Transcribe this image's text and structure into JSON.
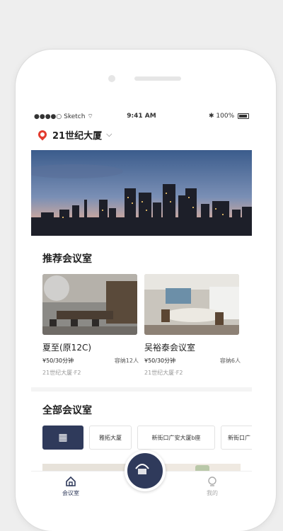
{
  "status_bar": {
    "carrier": "Sketch",
    "time": "9:41 AM",
    "battery": "100%"
  },
  "location": {
    "name": "21世纪大厦",
    "chevron_icon": "chevron-down-icon",
    "pin_icon": "map-pin-icon"
  },
  "recommended": {
    "title": "推荐会议室",
    "rooms": [
      {
        "name": "夏至(原12C)",
        "price": "¥50/30分钟",
        "capacity": "容纳12人",
        "address": "21世纪大厦·F2"
      },
      {
        "name": "吴裕泰会议室",
        "price": "¥50/30分钟",
        "capacity": "容纳6人",
        "address": "21世纪大厦·F2"
      }
    ]
  },
  "all_rooms": {
    "title": "全部会议室",
    "filters": [
      "",
      "雅拓大厦",
      "新街口广安大厦b座",
      "新街口广"
    ]
  },
  "tabbar": {
    "items": [
      {
        "label": "会议室",
        "icon": "home-icon",
        "active": true
      },
      {
        "label": "",
        "icon": "center-action-icon",
        "active": false
      },
      {
        "label": "我的",
        "icon": "user-icon",
        "active": false
      }
    ],
    "active_color": "#2f3a5b"
  },
  "colors": {
    "accent": "#2f3a5b",
    "pin": "#e23b2e"
  }
}
